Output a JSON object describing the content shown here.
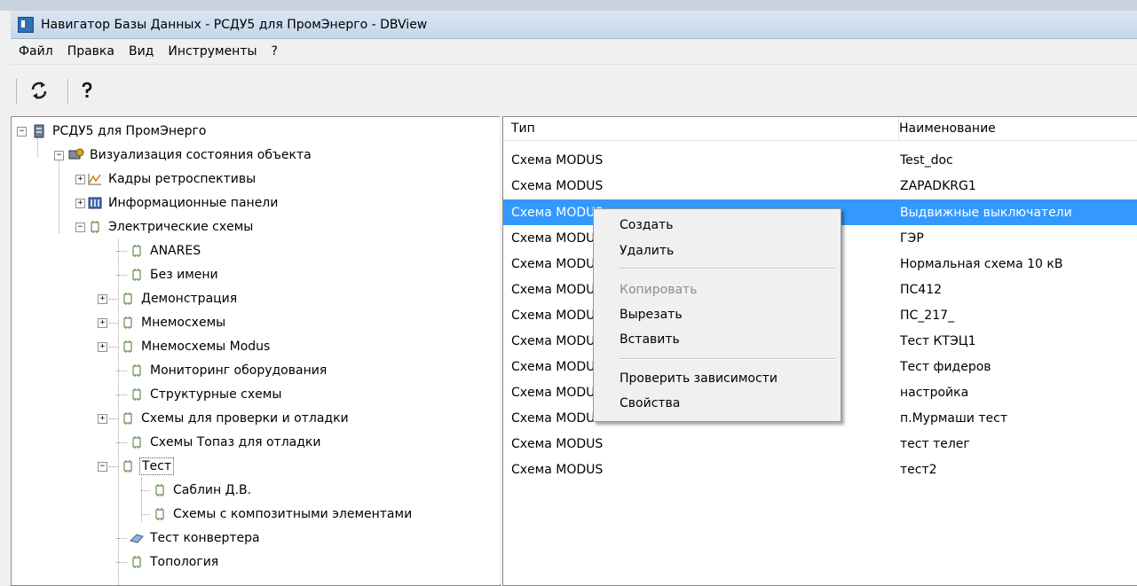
{
  "window": {
    "title": "Навигатор Базы Данных - РСДУ5 для ПромЭнерго - DBView"
  },
  "menu": [
    "Файл",
    "Правка",
    "Вид",
    "Инструменты",
    "?"
  ],
  "toolbar": {
    "buttons": [
      {
        "name": "refresh",
        "icon": "refresh-icon"
      },
      {
        "name": "help",
        "icon": "help-icon"
      }
    ]
  },
  "tree": {
    "root": "РСДУ5 для ПромЭнерго",
    "visualization": "Визуализация состояния объекта",
    "retrospective": "Кадры ретроспективы",
    "info_panels": "Информационные панели",
    "electrical": "Электрические схемы",
    "children": [
      "ANARES",
      "Без имени",
      "Демонстрация",
      "Мнемосхемы",
      "Мнемосхемы Modus",
      "Мониторинг оборудования",
      "Структурные схемы",
      "Схемы для проверки и отладки",
      "Схемы Топаз для отладки",
      "Тест",
      "Саблин Д.В.",
      "Схемы с композитными элементами",
      "Тест конвертера",
      "Топология"
    ]
  },
  "list": {
    "columns": [
      "Тип",
      "Наименование"
    ],
    "rows": [
      {
        "type": "Схема MODUS",
        "name": "Test_doc"
      },
      {
        "type": "Схема MODUS",
        "name": "ZAPADKRG1"
      },
      {
        "type": "Схема MODUS",
        "name": "Выдвижные выключатели"
      },
      {
        "type": "Схема MODUS",
        "name": "ГЭР"
      },
      {
        "type": "Схема MODUS",
        "name": "Нормальная схема 10 кВ"
      },
      {
        "type": "Схема MODUS",
        "name": "ПС412"
      },
      {
        "type": "Схема MODUS",
        "name": "ПС_217_"
      },
      {
        "type": "Схема MODUS",
        "name": "Тест КТЭЦ1"
      },
      {
        "type": "Схема MODUS",
        "name": "Тест фидеров"
      },
      {
        "type": "Схема MODUS",
        "name": "настройка"
      },
      {
        "type": "Схема MODUS",
        "name": "п.Мурмаши тест"
      },
      {
        "type": "Схема MODUS",
        "name": "тест телег"
      },
      {
        "type": "Схема MODUS",
        "name": "тест2"
      }
    ]
  },
  "context_menu": {
    "create": "Создать",
    "delete": "Удалить",
    "copy": "Копировать",
    "cut": "Вырезать",
    "paste": "Вставить",
    "check_deps": "Проверить зависимости",
    "properties": "Свойства"
  },
  "colors": {
    "selection": "#3399ff",
    "titlebar": "#c5d6ea"
  }
}
